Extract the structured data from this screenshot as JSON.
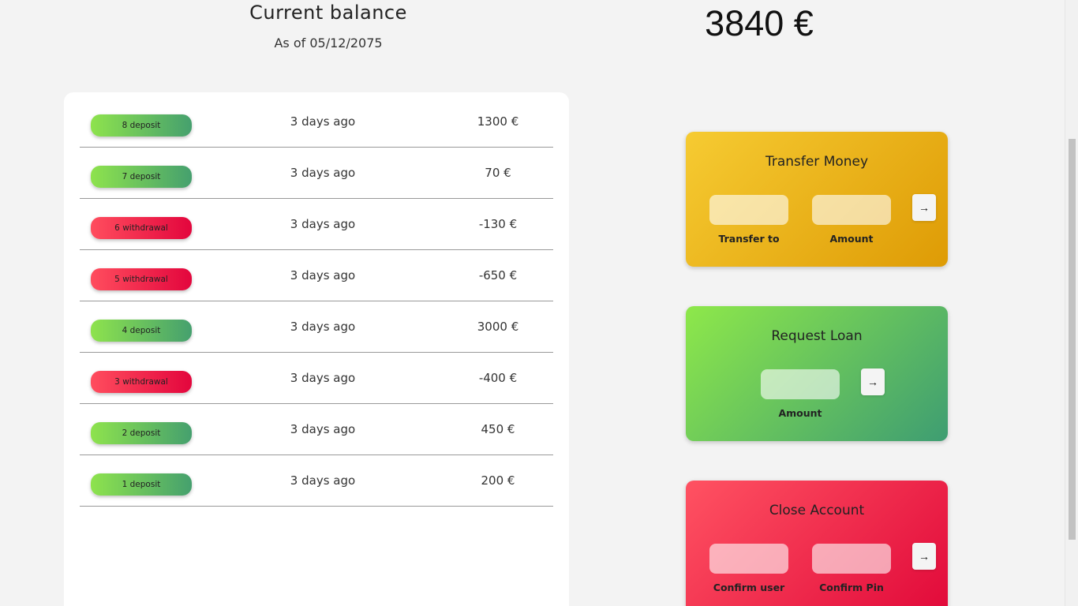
{
  "balance": {
    "label": "Current balance",
    "date_prefix": "As of 05/12/2075",
    "value": "3840 €"
  },
  "movements": [
    {
      "type": "deposit",
      "label": "8 deposit",
      "date": "3 days ago",
      "value": "1300 €"
    },
    {
      "type": "deposit",
      "label": "7 deposit",
      "date": "3 days ago",
      "value": "70 €"
    },
    {
      "type": "withdrawal",
      "label": "6 withdrawal",
      "date": "3 days ago",
      "value": "-130 €"
    },
    {
      "type": "withdrawal",
      "label": "5 withdrawal",
      "date": "3 days ago",
      "value": "-650 €"
    },
    {
      "type": "deposit",
      "label": "4 deposit",
      "date": "3 days ago",
      "value": "3000 €"
    },
    {
      "type": "withdrawal",
      "label": "3 withdrawal",
      "date": "3 days ago",
      "value": "-400 €"
    },
    {
      "type": "deposit",
      "label": "2 deposit",
      "date": "3 days ago",
      "value": "450 €"
    },
    {
      "type": "deposit",
      "label": "1 deposit",
      "date": "3 days ago",
      "value": "200 €"
    }
  ],
  "operations": {
    "transfer": {
      "title": "Transfer Money",
      "to_label": "Transfer to",
      "amount_label": "Amount",
      "button": "→"
    },
    "loan": {
      "title": "Request Loan",
      "amount_label": "Amount",
      "button": "→"
    },
    "close": {
      "title": "Close Account",
      "user_label": "Confirm user",
      "pin_label": "Confirm Pin",
      "button": "→"
    }
  },
  "colors": {
    "deposit_start": "#8ee34d",
    "deposit_end": "#45a06e",
    "withdrawal_start": "#ff4d5e",
    "withdrawal_end": "#e3063d",
    "transfer_start": "#f6cb32",
    "transfer_end": "#de9b05",
    "loan_start": "#8ee84a",
    "loan_end": "#3e9d72",
    "close_start": "#ff5262",
    "close_end": "#e00638"
  }
}
